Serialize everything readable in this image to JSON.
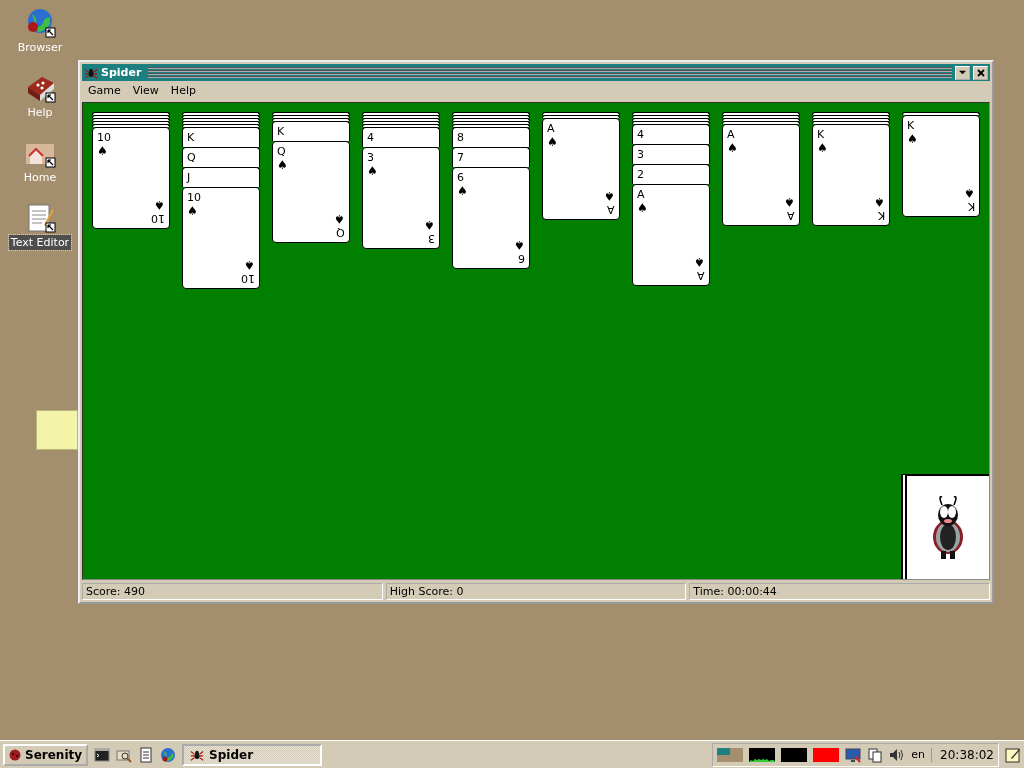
{
  "desktop": {
    "icons": [
      {
        "kind": "browser",
        "label": "Browser",
        "selected": false
      },
      {
        "kind": "help",
        "label": "Help",
        "selected": false
      },
      {
        "kind": "home",
        "label": "Home",
        "selected": false
      },
      {
        "kind": "editor",
        "label": "Text Editor",
        "selected": true
      }
    ]
  },
  "window": {
    "title": "Spider",
    "menu": [
      {
        "label": "Game"
      },
      {
        "label": "View"
      },
      {
        "label": "Help"
      }
    ],
    "columns": [
      {
        "cards": [
          {
            "face_up": false
          },
          {
            "face_up": false
          },
          {
            "face_up": false
          },
          {
            "face_up": false
          },
          {
            "face_up": false
          },
          {
            "face_up": true,
            "rank": "10",
            "suit": "♠",
            "bottom_rank": "10",
            "bottom_suit": "♠"
          }
        ]
      },
      {
        "cards": [
          {
            "face_up": false
          },
          {
            "face_up": false
          },
          {
            "face_up": false
          },
          {
            "face_up": false
          },
          {
            "face_up": false
          },
          {
            "face_up": true,
            "rank": "K"
          },
          {
            "face_up": true,
            "rank": "Q"
          },
          {
            "face_up": true,
            "rank": "J"
          },
          {
            "face_up": true,
            "rank": "10",
            "suit": "♠",
            "bottom_rank": "10",
            "bottom_suit": "♠"
          }
        ]
      },
      {
        "cards": [
          {
            "face_up": false
          },
          {
            "face_up": false
          },
          {
            "face_up": false
          },
          {
            "face_up": true,
            "rank": "K"
          },
          {
            "face_up": true,
            "rank": "Q",
            "suit": "♠",
            "bottom_rank": "Q",
            "bottom_suit": "♠"
          }
        ]
      },
      {
        "cards": [
          {
            "face_up": false
          },
          {
            "face_up": false
          },
          {
            "face_up": false
          },
          {
            "face_up": false
          },
          {
            "face_up": false
          },
          {
            "face_up": true,
            "rank": "4"
          },
          {
            "face_up": true,
            "rank": "3",
            "suit": "♠",
            "bottom_rank": "3",
            "bottom_suit": "♠"
          }
        ]
      },
      {
        "cards": [
          {
            "face_up": false
          },
          {
            "face_up": false
          },
          {
            "face_up": false
          },
          {
            "face_up": false
          },
          {
            "face_up": false
          },
          {
            "face_up": true,
            "rank": "8"
          },
          {
            "face_up": true,
            "rank": "7"
          },
          {
            "face_up": true,
            "rank": "6",
            "suit": "♠",
            "bottom_rank": "6",
            "bottom_suit": "♠"
          }
        ]
      },
      {
        "cards": [
          {
            "face_up": false
          },
          {
            "face_up": false
          },
          {
            "face_up": true,
            "rank": "A",
            "suit": "♠",
            "bottom_rank": "A",
            "bottom_suit": "♠"
          }
        ]
      },
      {
        "cards": [
          {
            "face_up": false
          },
          {
            "face_up": false
          },
          {
            "face_up": false
          },
          {
            "face_up": false
          },
          {
            "face_up": true,
            "rank": "4"
          },
          {
            "face_up": true,
            "rank": "3"
          },
          {
            "face_up": true,
            "rank": "2"
          },
          {
            "face_up": true,
            "rank": "A",
            "suit": "♠",
            "bottom_rank": "A",
            "bottom_suit": "♠"
          }
        ]
      },
      {
        "cards": [
          {
            "face_up": false
          },
          {
            "face_up": false
          },
          {
            "face_up": false
          },
          {
            "face_up": false
          },
          {
            "face_up": true,
            "rank": "A",
            "suit": "♠",
            "bottom_rank": "A",
            "bottom_suit": "♠"
          }
        ]
      },
      {
        "cards": [
          {
            "face_up": false
          },
          {
            "face_up": false
          },
          {
            "face_up": false
          },
          {
            "face_up": false
          },
          {
            "face_up": true,
            "rank": "K",
            "suit": "♠",
            "bottom_rank": "K",
            "bottom_suit": "♠"
          }
        ]
      },
      {
        "cards": [
          {
            "face_up": false
          },
          {
            "face_up": true,
            "rank": "K",
            "suit": "♠",
            "bottom_rank": "K",
            "bottom_suit": "♠"
          }
        ]
      }
    ],
    "status_bar": [
      {
        "text": "Score: 490"
      },
      {
        "text": "High Score: 0"
      },
      {
        "text": "Time: 00:00:44"
      }
    ]
  },
  "taskbar": {
    "start": "Serenity",
    "quick_launch": [
      {
        "kind": "terminal"
      },
      {
        "kind": "files"
      },
      {
        "kind": "notes"
      },
      {
        "kind": "browser"
      }
    ],
    "tasks": [
      {
        "label": "Spider",
        "selected": true
      }
    ],
    "keyboard": "en",
    "clock": "20:38:02"
  }
}
